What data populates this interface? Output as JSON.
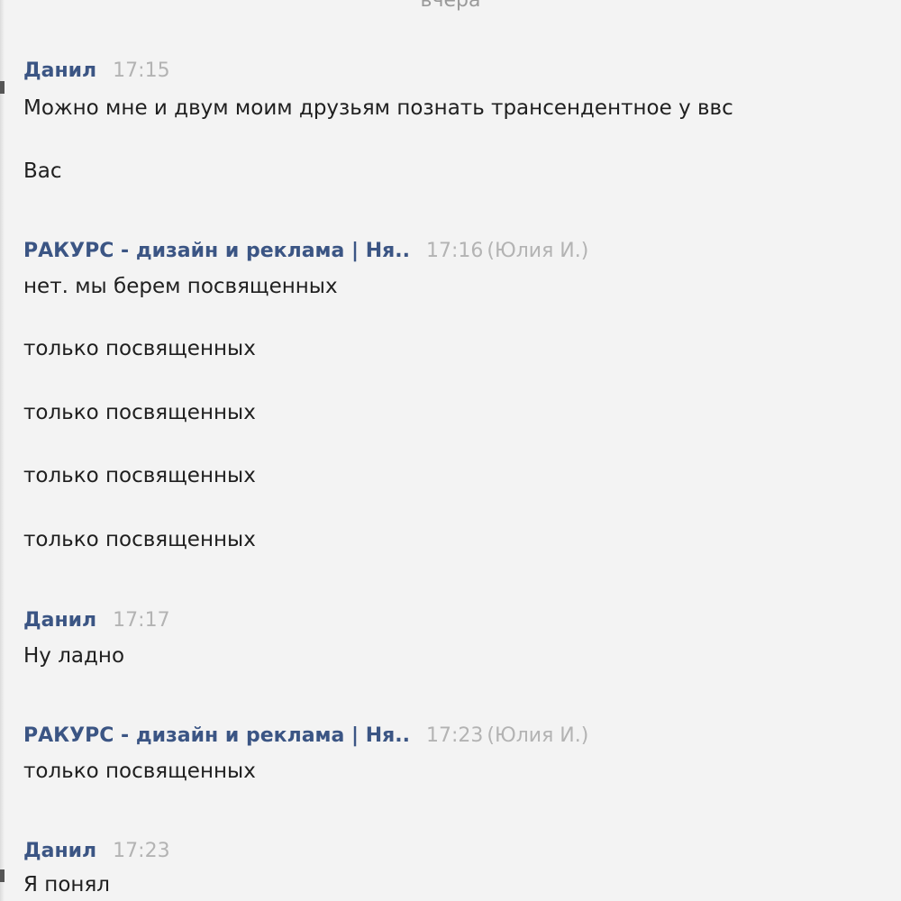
{
  "chat": {
    "date_separator": "вчера",
    "messages": [
      {
        "author": "Данил",
        "time": "17:15",
        "sender_note": "",
        "lines": [
          "Можно мне и двум моим друзьям познать трансендентное у ввс",
          "Вас"
        ]
      },
      {
        "author": "РАКУРС - дизайн и реклама | Ня..",
        "time": "17:16",
        "sender_note": "(Юлия И.)",
        "lines": [
          "нет. мы берем посвященных",
          "только посвященных",
          "только посвященных",
          "только посвященных",
          "только посвященных"
        ]
      },
      {
        "author": "Данил",
        "time": "17:17",
        "sender_note": "",
        "lines": [
          "Ну ладно"
        ]
      },
      {
        "author": "РАКУРС - дизайн и реклама | Ня..",
        "time": "17:23",
        "sender_note": "(Юлия И.)",
        "lines": [
          "только посвященных"
        ]
      },
      {
        "author": "Данил",
        "time": "17:23",
        "sender_note": "",
        "lines": [
          "Я понял"
        ]
      }
    ]
  }
}
